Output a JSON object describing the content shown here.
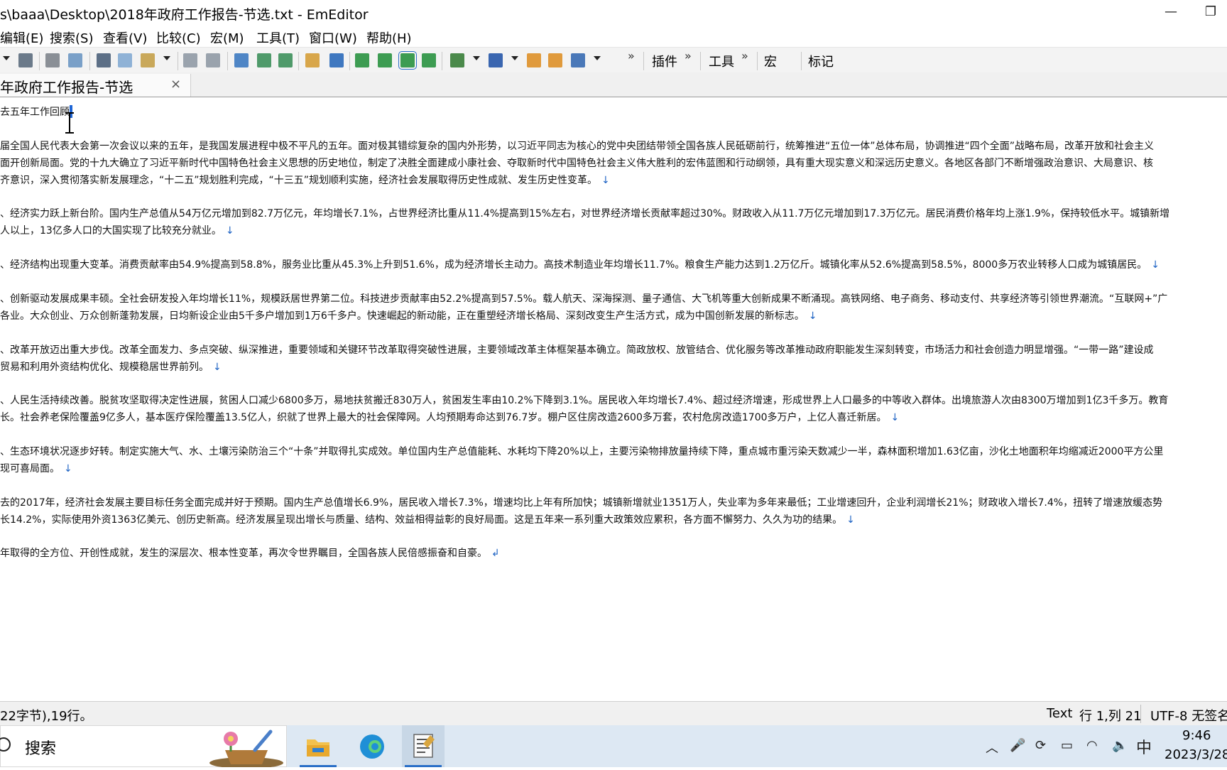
{
  "window": {
    "title": "s\\baaa\\Desktop\\2018年政府工作报告-节选.txt - EmEditor",
    "minimize_icon": "minimize-icon",
    "restore_icon": "restore-icon"
  },
  "menu": {
    "items": [
      "编辑(E)",
      "搜索(S)",
      "查看(V)",
      "比较(C)",
      "宏(M)",
      "工具(T)",
      "窗口(W)",
      "帮助(H)"
    ]
  },
  "toolbar": {
    "labels": {
      "plugins": "插件",
      "tools": "工具",
      "macros": "宏",
      "markers": "标记"
    },
    "chevron": "»"
  },
  "tab": {
    "label": "年政府工作报告-节选",
    "close": "×"
  },
  "document": {
    "lines": [
      "去五年工作回顾",
      "",
      "届全国人民代表大会第一次会议以来的五年，是我国发展进程中极不平凡的五年。面对极其错综复杂的国内外形势，以习近平同志为核心的党中央团结带领全国各族人民砥砺前行，统筹推进“五位一体”总体布局，协调推进“四个全面”战略布局，改革开放和社会主义",
      "面开创新局面。党的十九大确立了习近平新时代中国特色社会主义思想的历史地位，制定了决胜全面建成小康社会、夺取新时代中国特色社会主义伟大胜利的宏伟蓝图和行动纲领，具有重大现实意义和深远历史意义。各地区各部门不断增强政治意识、大局意识、核",
      "齐意识，深入贯彻落实新发展理念，“十二五”规划胜利完成，“十三五”规划顺利实施，经济社会发展取得历史性成就、发生历史性变革。",
      "",
      "、经济实力跃上新台阶。国内生产总值从54万亿元增加到82.7万亿元，年均增长7.1%，占世界经济比重从11.4%提高到15%左右，对世界经济增长贡献率超过30%。财政收入从11.7万亿元增加到17.3万亿元。居民消费价格年均上涨1.9%，保持较低水平。城镇新增",
      "人以上，13亿多人口的大国实现了比较充分就业。",
      "",
      "、经济结构出现重大变革。消费贡献率由54.9%提高到58.8%，服务业比重从45.3%上升到51.6%，成为经济增长主动力。高技术制造业年均增长11.7%。粮食生产能力达到1.2万亿斤。城镇化率从52.6%提高到58.5%，8000多万农业转移人口成为城镇居民。",
      "",
      "、创新驱动发展成果丰硕。全社会研发投入年均增长11%，规模跃居世界第二位。科技进步贡献率由52.2%提高到57.5%。载人航天、深海探测、量子通信、大飞机等重大创新成果不断涌现。高铁网络、电子商务、移动支付、共享经济等引领世界潮流。“互联网+”广",
      "各业。大众创业、万众创新蓬勃发展，日均新设企业由5千多户增加到1万6千多户。快速崛起的新动能，正在重塑经济增长格局、深刻改变生产生活方式，成为中国创新发展的新标志。",
      "",
      "、改革开放迈出重大步伐。改革全面发力、多点突破、纵深推进，重要领域和关键环节改革取得突破性进展，主要领域改革主体框架基本确立。简政放权、放管结合、优化服务等改革推动政府职能发生深刻转变，市场活力和社会创造力明显增强。“一带一路”建设成",
      "贸易和利用外资结构优化、规模稳居世界前列。",
      "",
      "、人民生活持续改善。脱贫攻坚取得决定性进展，贫困人口减少6800多万，易地扶贫搬迁830万人，贫困发生率由10.2%下降到3.1%。居民收入年均增长7.4%、超过经济增速，形成世界上人口最多的中等收入群体。出境旅游人次由8300万增加到1亿3千多万。教育",
      "长。社会养老保险覆盖9亿多人，基本医疗保险覆盖13.5亿人，织就了世界上最大的社会保障网。人均预期寿命达到76.7岁。棚户区住房改造2600多万套，农村危房改造1700多万户，上亿人喜迁新居。",
      "",
      "、生态环境状况逐步好转。制定实施大气、水、土壤污染防治三个“十条”并取得扎实成效。单位国内生产总值能耗、水耗均下降20%以上，主要污染物排放量持续下降，重点城市重污染天数减少一半，森林面积增加1.63亿亩，沙化土地面积年均缩减近2000平方公里",
      "现可喜局面。",
      "",
      "去的2017年，经济社会发展主要目标任务全面完成并好于预期。国内生产总值增长6.9%，居民收入增长7.3%，增速均比上年有所加快；城镇新增就业1351万人，失业率为多年来最低；工业增速回升，企业利润增长21%；财政收入增长7.4%，扭转了增速放缓态势",
      "长14.2%，实际使用外资1363亿美元、创历史新高。经济发展呈现出增长与质量、结构、效益相得益彰的良好局面。这是五年来一系列重大政策效应累积，各方面不懈努力、久久为功的结果。",
      "",
      "年取得的全方位、开创性成就，发生的深层次、根本性变革，再次令世界瞩目，全国各族人民倍感振奋和自豪。"
    ],
    "eol_marks": [
      "",
      "",
      "",
      "",
      "↓",
      "",
      "",
      "↓",
      "",
      "↓",
      "",
      "",
      "↓",
      "",
      "",
      "↓",
      "",
      "",
      "↓",
      "",
      "",
      "↓",
      "",
      "",
      "↓",
      "",
      "↲"
    ]
  },
  "status": {
    "left": "22字节),19行。",
    "mode": "Text",
    "position": "行 1,列 21",
    "encoding": "UTF-8 无签名"
  },
  "taskbar": {
    "search_label": "搜索",
    "ime": "中",
    "time": "9:46",
    "date": "2023/3/28"
  },
  "colors": {
    "selection": "#1f66d6",
    "eol_mark": "#1e63c4",
    "taskbar_bg": "#dde8f3"
  }
}
